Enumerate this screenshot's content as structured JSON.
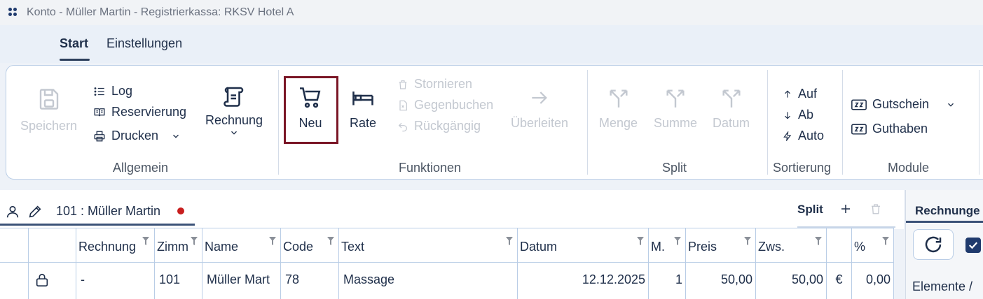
{
  "window": {
    "title": "Konto - Müller Martin - Registrierkassa: RKSV Hotel A"
  },
  "tabs": [
    {
      "label": "Start",
      "active": true
    },
    {
      "label": "Einstellungen",
      "active": false
    }
  ],
  "ribbon": {
    "allgemein": {
      "label": "Allgemein",
      "save": "Speichern",
      "log": "Log",
      "reservierung": "Reservierung",
      "drucken": "Drucken",
      "rechnung": "Rechnung"
    },
    "funktionen": {
      "label": "Funktionen",
      "neu": "Neu",
      "rate": "Rate",
      "stornieren": "Stornieren",
      "gegenbuchen": "Gegenbuchen",
      "rueckgaengig": "Rückgängig",
      "ueberleiten": "Überleiten"
    },
    "split": {
      "label": "Split",
      "menge": "Menge",
      "summe": "Summe",
      "datum": "Datum"
    },
    "sortierung": {
      "label": "Sortierung",
      "auf": "Auf",
      "ab": "Ab",
      "auto": "Auto"
    },
    "module": {
      "label": "Module",
      "gutschein": "Gutschein",
      "guthaben": "Guthaben"
    }
  },
  "account": {
    "label": "101 :  Müller Martin",
    "split_label": "Split",
    "status_color": "#c81e1e"
  },
  "table": {
    "headers": [
      "Rechnung",
      "Zimm",
      "Name",
      "Code",
      "Text",
      "Datum",
      "M.",
      "Preis",
      "Zws.",
      "%"
    ],
    "row": {
      "rechnung": "-",
      "zimmer": "101",
      "name": "Müller Mart",
      "code": "78",
      "text": "Massage",
      "datum": "12.12.2025",
      "menge": "1",
      "preis": "50,00",
      "zws": "50,00",
      "currency": "€",
      "prozent": "0,00"
    }
  },
  "right_panel": {
    "tab": "Rechnunge",
    "label": "Elemente /"
  },
  "colors": {
    "accent": "#1f3a6d",
    "highlight_border": "#7a1626",
    "disabled": "#c3c8d0"
  }
}
